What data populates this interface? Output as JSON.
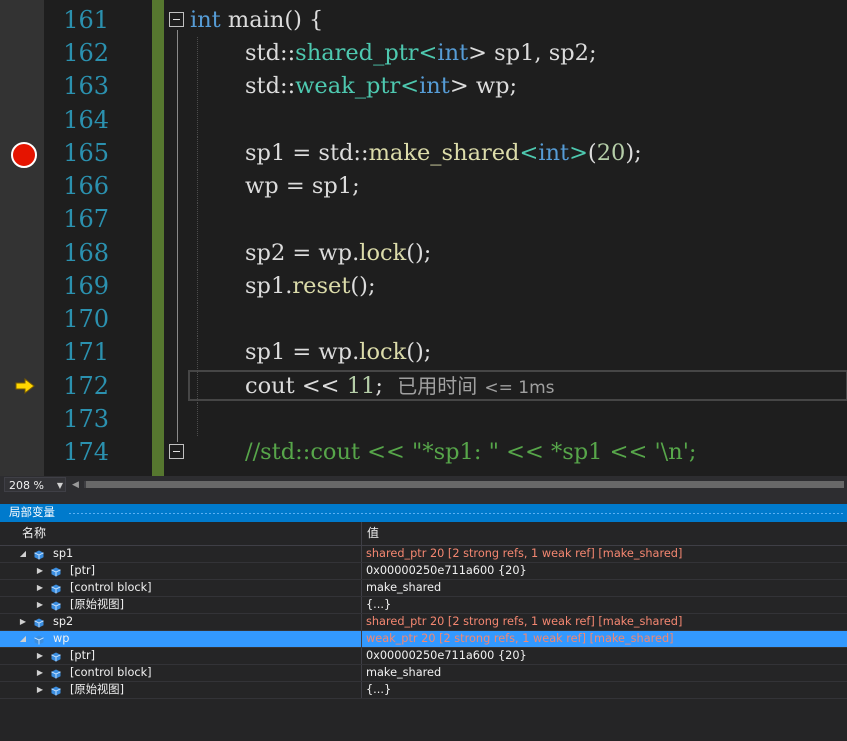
{
  "editor": {
    "line_numbers": [
      "161",
      "162",
      "163",
      "164",
      "165",
      "166",
      "167",
      "168",
      "169",
      "170",
      "171",
      "172",
      "173",
      "174"
    ],
    "lines": {
      "l161": {
        "kw": "int",
        "rest": " main() {"
      },
      "l162": {
        "a": "std::",
        "ty": "shared_ptr",
        "lt": "<",
        "kw": "int",
        "rest": "> sp1, sp2;"
      },
      "l163": {
        "a": "std::",
        "ty": "weak_ptr",
        "lt": "<",
        "kw": "int",
        "rest": "> wp;"
      },
      "l165": {
        "a": "sp1 = std::",
        "fn": "make_shared",
        "lt": "<",
        "kw": "int",
        "gt": ">",
        "p1": "(",
        "num": "20",
        "p2": ");"
      },
      "l166": {
        "text": "wp = sp1;"
      },
      "l168": {
        "a": "sp2 = wp.",
        "fn": "lock",
        "b": "();"
      },
      "l169": {
        "a": "sp1.",
        "fn": "reset",
        "b": "();"
      },
      "l171": {
        "a": "sp1 = wp.",
        "fn": "lock",
        "b": "();"
      },
      "l172": {
        "a": "cout << ",
        "num": "11",
        "b": ";",
        "perf_label": "已用时间",
        "perf_value": "<= 1ms"
      },
      "l174": {
        "comment": "//std::cout << \"*sp1: \" << *sp1 << '\\n';"
      }
    },
    "breakpoint_line": "165",
    "current_line": "172",
    "breakpoint_color": "#e51400",
    "ip_arrow_color": "#ffd700"
  },
  "zoom": {
    "level": "208 %"
  },
  "locals": {
    "title": "局部变量",
    "columns": {
      "name": "名称",
      "value": "值"
    },
    "rows": [
      {
        "name": "sp1",
        "value": "shared_ptr 20 [2 strong refs, 1 weak ref] [make_shared]",
        "level": 0,
        "expanded": true,
        "changed": true,
        "selected": false
      },
      {
        "name": "[ptr]",
        "value": "0x00000250e711a600 {20}",
        "level": 1,
        "expanded": false,
        "changed": false,
        "selected": false
      },
      {
        "name": "[control block]",
        "value": "make_shared",
        "level": 1,
        "expanded": false,
        "changed": false,
        "selected": false
      },
      {
        "name": "[原始视图]",
        "value": "{...}",
        "level": 1,
        "expanded": false,
        "changed": false,
        "selected": false
      },
      {
        "name": "sp2",
        "value": "shared_ptr 20 [2 strong refs, 1 weak ref] [make_shared]",
        "level": 0,
        "expanded": false,
        "changed": true,
        "selected": false
      },
      {
        "name": "wp",
        "value": "weak_ptr 20 [2 strong refs, 1 weak ref] [make_shared]",
        "level": 0,
        "expanded": true,
        "changed": true,
        "selected": true
      },
      {
        "name": "[ptr]",
        "value": "0x00000250e711a600 {20}",
        "level": 1,
        "expanded": false,
        "changed": false,
        "selected": false
      },
      {
        "name": "[control block]",
        "value": "make_shared",
        "level": 1,
        "expanded": false,
        "changed": false,
        "selected": false
      },
      {
        "name": "[原始视图]",
        "value": "{...}",
        "level": 1,
        "expanded": false,
        "changed": false,
        "selected": false
      }
    ],
    "accent_color": "#007acc",
    "changed_color": "#f48771",
    "selected_color": "#3399ff"
  }
}
